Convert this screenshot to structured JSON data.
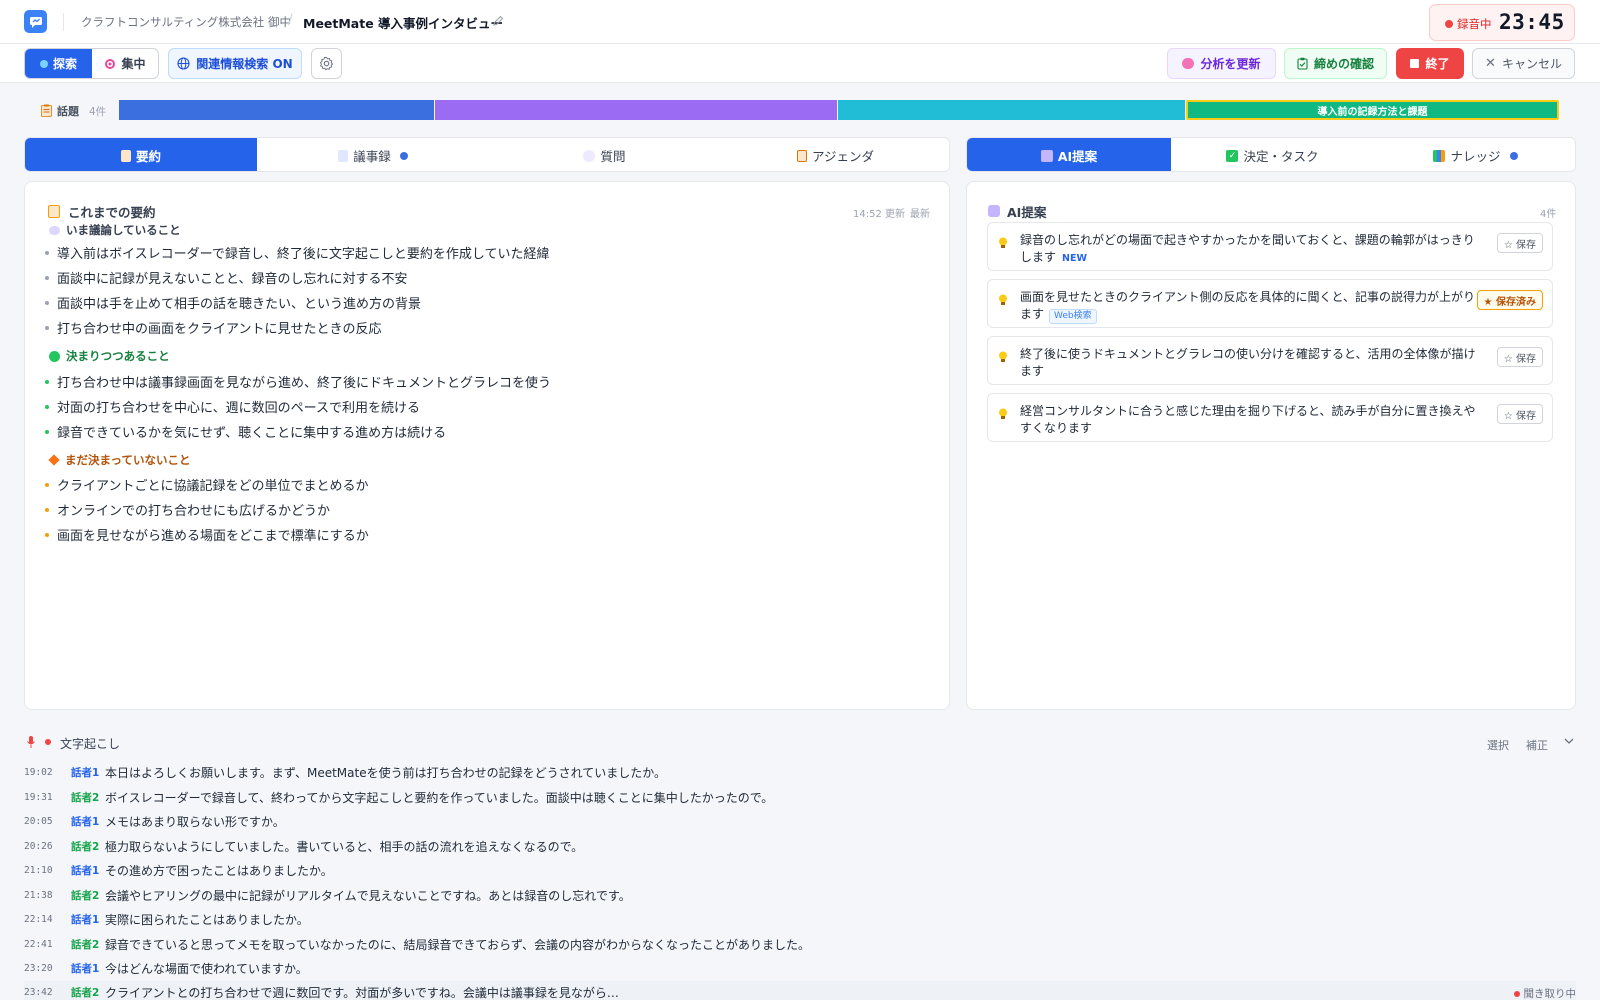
{
  "header": {
    "company": "クラフトコンサルティング株式会社 御中",
    "separator": "/",
    "meeting_title": "MeetMate 導入事例インタビュー",
    "recording_label": "録音中",
    "recording_time": "23:45"
  },
  "toolbar": {
    "mode_explore": "探索",
    "mode_focus": "集中",
    "related_search": "関連情報検索 ON",
    "update_analysis": "分析を更新",
    "confirm_closing": "締めの確認",
    "end": "終了",
    "cancel": "キャンセル"
  },
  "topics": {
    "label": "話題",
    "count": "4件",
    "active_topic_label": "導入前の記録方法と課題",
    "colors": [
      "#3b6fe0",
      "#9b6cf3",
      "#21bcd5",
      "#10b981"
    ]
  },
  "left_tabs": [
    "要約",
    "議事録",
    "質問",
    "アジェンダ"
  ],
  "right_tabs": [
    "AI提案",
    "決定・タスク",
    "ナレッジ"
  ],
  "summary": {
    "title": "これまでの要約",
    "updated": "14:52 更新",
    "latest": "最新",
    "discussing_heading": "いま議論していること",
    "discussing": [
      "導入前はボイスレコーダーで録音し、終了後に文字起こしと要約を作成していた経緯",
      "面談中に記録が見えないことと、録音のし忘れに対する不安",
      "面談中は手を止めて相手の話を聴きたい、という進め方の背景",
      "打ち合わせ中の画面をクライアントに見せたときの反応"
    ],
    "deciding_heading": "決まりつつあること",
    "deciding": [
      "打ち合わせ中は議事録画面を見ながら進め、終了後にドキュメントとグラレコを使う",
      "対面の打ち合わせを中心に、週に数回のペースで利用を続ける",
      "録音できているかを気にせず、聴くことに集中する進め方は続ける"
    ],
    "undecided_heading": "まだ決まっていないこと",
    "undecided": [
      "クライアントごとに協議記録をどの単位でまとめるか",
      "オンラインでの打ち合わせにも広げるかどうか",
      "画面を見せながら進める場面をどこまで標準にするか"
    ]
  },
  "ai": {
    "title": "AI提案",
    "count": "4件",
    "cards": [
      {
        "text": "録音のし忘れがどの場面で起きやすかったかを聞いておくと、課題の輪郭がはっきりします",
        "tag": "NEW",
        "save": "☆ 保存"
      },
      {
        "text": "画面を見せたときのクライアント側の反応を具体的に聞くと、記事の説得力が上がります",
        "tag": "Web検索",
        "save": "★ 保存済み"
      },
      {
        "text": "終了後に使うドキュメントとグラレコの使い分けを確認すると、活用の全体像が描けます",
        "tag": "",
        "save": "☆ 保存"
      },
      {
        "text": "経営コンサルタントに合うと感じた理由を掘り下げると、読み手が自分に置き換えやすくなります",
        "tag": "",
        "save": "☆ 保存"
      }
    ]
  },
  "transcript": {
    "title": "文字起こし",
    "select": "選択",
    "correct": "補正",
    "live": "聞き取り中",
    "rows": [
      {
        "time": "19:02",
        "speaker": "話者1",
        "text": "本日はよろしくお願いします。まず、MeetMateを使う前は打ち合わせの記録をどうされていましたか。"
      },
      {
        "time": "19:31",
        "speaker": "話者2",
        "text": "ボイスレコーダーで録音して、終わってから文字起こしと要約を作っていました。面談中は聴くことに集中したかったので。"
      },
      {
        "time": "20:05",
        "speaker": "話者1",
        "text": "メモはあまり取らない形ですか。"
      },
      {
        "time": "20:26",
        "speaker": "話者2",
        "text": "極力取らないようにしていました。書いていると、相手の話の流れを追えなくなるので。"
      },
      {
        "time": "21:10",
        "speaker": "話者1",
        "text": "その進め方で困ったことはありましたか。"
      },
      {
        "time": "21:38",
        "speaker": "話者2",
        "text": "会議やヒアリングの最中に記録がリアルタイムで見えないことですね。あとは録音のし忘れです。"
      },
      {
        "time": "22:14",
        "speaker": "話者1",
        "text": "実際に困られたことはありましたか。"
      },
      {
        "time": "22:41",
        "speaker": "話者2",
        "text": "録音できていると思ってメモを取っていなかったのに、結局録音できておらず、会議の内容がわからなくなったことがありました。"
      },
      {
        "time": "23:20",
        "speaker": "話者1",
        "text": "今はどんな場面で使われていますか。"
      },
      {
        "time": "23:42",
        "speaker": "話者2",
        "text": "クライアントとの打ち合わせで週に数回です。対面が多いですね。会議中は議事録を見ながら…"
      }
    ]
  }
}
